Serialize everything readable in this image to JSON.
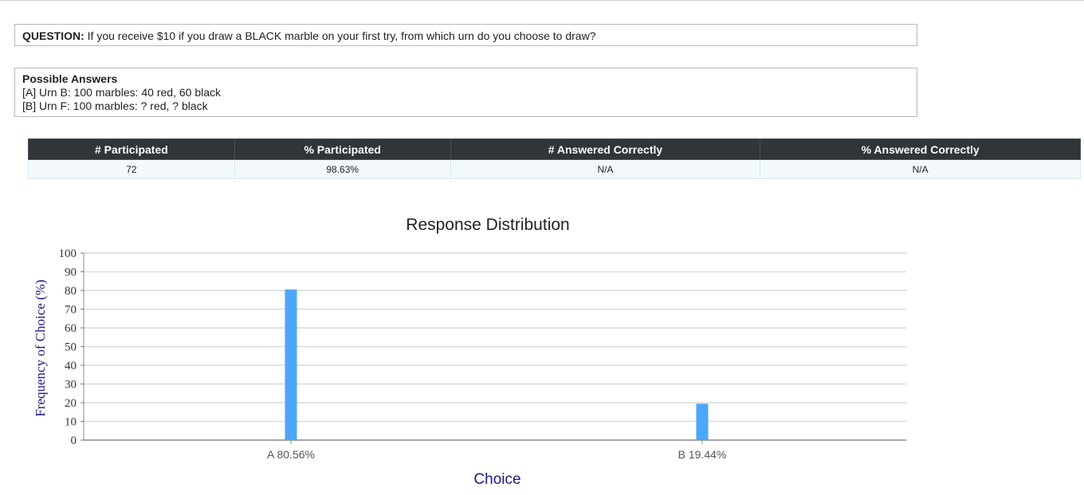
{
  "question": {
    "prefix": "QUESTION:",
    "text": "If you receive $10 if you draw a BLACK marble on your first try, from which urn do you choose to draw?"
  },
  "answers": {
    "heading": "Possible Answers",
    "items": [
      "[A] Urn B: 100 marbles: 40 red, 60 black",
      "[B] Urn F: 100 marbles: ? red, ? black"
    ]
  },
  "stats_table": {
    "headers": [
      "# Participated",
      "% Participated",
      "# Answered Correctly",
      "% Answered Correctly"
    ],
    "row": [
      "72",
      "98.63%",
      "N/A",
      "N/A"
    ]
  },
  "chart_data": {
    "type": "bar",
    "title": "Response Distribution",
    "xlabel": "Choice",
    "ylabel": "Frequency of Choice (%)",
    "categories": [
      "A 80.56%",
      "B 19.44%"
    ],
    "values": [
      80.56,
      19.44
    ],
    "ylim": [
      0,
      100
    ],
    "yticks": [
      0,
      10,
      20,
      30,
      40,
      50,
      60,
      70,
      80,
      90,
      100
    ],
    "grid": true,
    "bar_color": "#4da6f7",
    "axis_title_color": "#1a1a80"
  }
}
